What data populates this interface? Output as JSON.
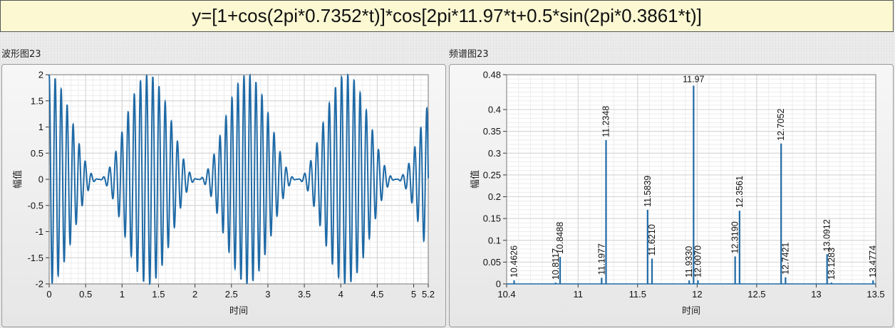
{
  "formula": "y=[1+cos(2pi*0.7352*t)]*cos[2pi*11.97*t+0.5*sin(2pi*0.3861*t)]",
  "colors": {
    "line": "#1f6aa6",
    "plot_bg": "#ffffff",
    "grid_major": "#d2d2d2",
    "grid_minor": "#ececec"
  },
  "chart_data": [
    {
      "type": "line",
      "title": "波形图23",
      "xlabel": "时间",
      "ylabel": "幅值",
      "xlim": [
        0,
        5.2
      ],
      "ylim": [
        -2,
        2
      ],
      "xticks": [
        "0",
        "0.5",
        "1",
        "1.5",
        "2",
        "2.5",
        "3",
        "3.5",
        "4",
        "4.5",
        "5",
        "5.2"
      ],
      "xtick_values": [
        0,
        0.5,
        1,
        1.5,
        2,
        2.5,
        3,
        3.5,
        4,
        4.5,
        5,
        5.2
      ],
      "yticks": [
        "2",
        "1.5",
        "1",
        "0.5",
        "0",
        "-0.5",
        "-1",
        "-1.5",
        "-2"
      ],
      "ytick_values": [
        2,
        1.5,
        1,
        0.5,
        0,
        -0.5,
        -1,
        -1.5,
        -2
      ],
      "grid": true,
      "series": [
        {
          "function": "(1+cos(2*pi*0.7352*t))*cos(2*pi*11.97*t+0.5*sin(2*pi*0.3861*t))",
          "t_range": [
            0,
            5.2
          ],
          "color": "#1f6aa6"
        }
      ]
    },
    {
      "type": "line",
      "title": "频谱图23",
      "xlabel": "时间",
      "ylabel": "幅值",
      "xlim": [
        10.4,
        13.5
      ],
      "ylim": [
        0,
        0.48
      ],
      "xticks": [
        "10.4",
        "11",
        "11.5",
        "12",
        "12.5",
        "13",
        "13.5"
      ],
      "xtick_values": [
        10.4,
        11,
        11.5,
        12,
        12.5,
        13,
        13.5
      ],
      "yticks": [
        "0.48",
        "0.4",
        "0.35",
        "0.3",
        "0.25",
        "0.2",
        "0.15",
        "0.1",
        "0.05",
        "0"
      ],
      "ytick_values": [
        0.48,
        0.4,
        0.35,
        0.3,
        0.25,
        0.2,
        0.15,
        0.1,
        0.05,
        0
      ],
      "grid": true,
      "peaks": [
        {
          "x": 10.4626,
          "y": 0.008,
          "label": "10.4626"
        },
        {
          "x": 10.8117,
          "y": 0.003,
          "label": "10.8117"
        },
        {
          "x": 10.8488,
          "y": 0.062,
          "label": "10.8488"
        },
        {
          "x": 11.1977,
          "y": 0.014,
          "label": "11.1977"
        },
        {
          "x": 11.2348,
          "y": 0.33,
          "label": "11.2348"
        },
        {
          "x": 11.5839,
          "y": 0.17,
          "label": "11.5839"
        },
        {
          "x": 11.621,
          "y": 0.058,
          "label": "11.6210"
        },
        {
          "x": 11.933,
          "y": 0.008,
          "label": "11.9330"
        },
        {
          "x": 11.97,
          "y": 0.455,
          "label": "11.97"
        },
        {
          "x": 12.007,
          "y": 0.008,
          "label": "12.0070"
        },
        {
          "x": 12.319,
          "y": 0.063,
          "label": "12.3190"
        },
        {
          "x": 12.3561,
          "y": 0.168,
          "label": "12.3561"
        },
        {
          "x": 12.7052,
          "y": 0.322,
          "label": "12.7052"
        },
        {
          "x": 12.7421,
          "y": 0.015,
          "label": "12.7421"
        },
        {
          "x": 13.0912,
          "y": 0.068,
          "label": "13.0912"
        },
        {
          "x": 13.1283,
          "y": 0.003,
          "label": "13.1283"
        },
        {
          "x": 13.4774,
          "y": 0.008,
          "label": "13.4774"
        }
      ]
    }
  ]
}
